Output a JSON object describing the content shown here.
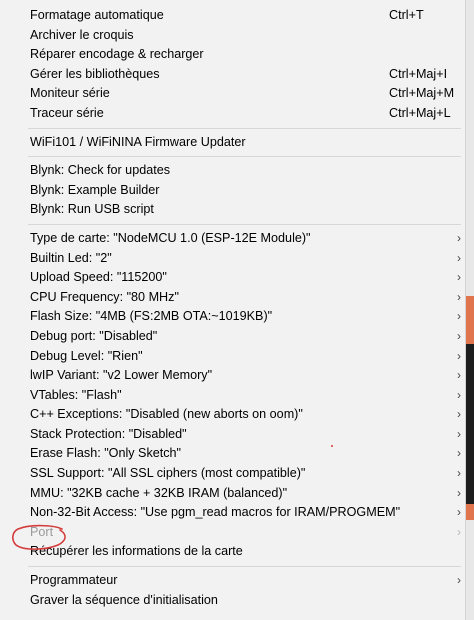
{
  "menu": {
    "group1": [
      {
        "label": "Formatage automatique",
        "shortcut": "Ctrl+T"
      },
      {
        "label": "Archiver le croquis",
        "shortcut": ""
      },
      {
        "label": "Réparer encodage & recharger",
        "shortcut": ""
      },
      {
        "label": "Gérer les bibliothèques",
        "shortcut": "Ctrl+Maj+I"
      },
      {
        "label": "Moniteur série",
        "shortcut": "Ctrl+Maj+M"
      },
      {
        "label": "Traceur série",
        "shortcut": "Ctrl+Maj+L"
      }
    ],
    "group2": [
      {
        "label": "WiFi101 / WiFiNINA Firmware Updater"
      }
    ],
    "group3": [
      {
        "label": "Blynk: Check for updates"
      },
      {
        "label": "Blynk: Example Builder"
      },
      {
        "label": "Blynk: Run USB script"
      }
    ],
    "group4": [
      {
        "label": "Type de carte: \"NodeMCU 1.0 (ESP-12E Module)\""
      },
      {
        "label": "Builtin Led: \"2\""
      },
      {
        "label": "Upload Speed: \"115200\""
      },
      {
        "label": "CPU Frequency: \"80 MHz\""
      },
      {
        "label": "Flash Size: \"4MB (FS:2MB OTA:~1019KB)\""
      },
      {
        "label": "Debug port: \"Disabled\""
      },
      {
        "label": "Debug Level: \"Rien\""
      },
      {
        "label": "lwIP Variant: \"v2 Lower Memory\""
      },
      {
        "label": "VTables: \"Flash\""
      },
      {
        "label": "C++ Exceptions: \"Disabled (new aborts on oom)\""
      },
      {
        "label": "Stack Protection: \"Disabled\""
      },
      {
        "label": "Erase Flash: \"Only Sketch\""
      },
      {
        "label": "SSL Support: \"All SSL ciphers (most compatible)\""
      },
      {
        "label": "MMU: \"32KB cache + 32KB IRAM (balanced)\""
      },
      {
        "label": "Non-32-Bit Access: \"Use pgm_read macros for IRAM/PROGMEM\""
      },
      {
        "label": "Port"
      },
      {
        "label": "Récupérer les informations de la carte"
      }
    ],
    "group5": [
      {
        "label": "Programmateur"
      },
      {
        "label": "Graver la séquence d'initialisation"
      }
    ],
    "submenu_arrow": "›"
  },
  "icons": {
    "submenu": "chevron-right-icon"
  },
  "colors": {
    "menu_bg": "#f2f2f2",
    "disabled_text": "#9a9a9a",
    "annotation_red": "#d43b3b",
    "accent_orange": "#e0744c"
  }
}
